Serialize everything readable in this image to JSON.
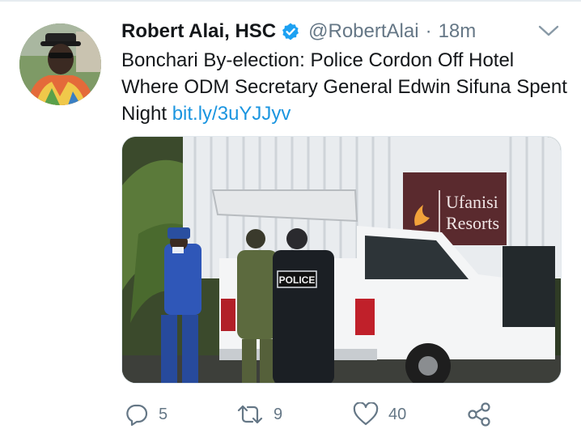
{
  "tweet": {
    "author": {
      "display_name": "Robert Alai, HSC",
      "handle": "@RobertAlai",
      "verified": true
    },
    "separator": "·",
    "time": "18m",
    "text_main": "Bonchari By-election: Police Cordon Off Hotel Where ODM Secretary General Edwin Sifuna Spent Night",
    "text_link": "bit.ly/3uYJJyv",
    "media": {
      "sign_text_1": "Ufanisi",
      "sign_text_2": "Resorts",
      "vest_text": "POLICE"
    },
    "actions": {
      "reply_count": "5",
      "retweet_count": "9",
      "like_count": "40"
    }
  },
  "colors": {
    "text_primary": "#14171a",
    "text_secondary": "#657786",
    "link": "#1b95e0",
    "verified_badge": "#1da1f2"
  }
}
